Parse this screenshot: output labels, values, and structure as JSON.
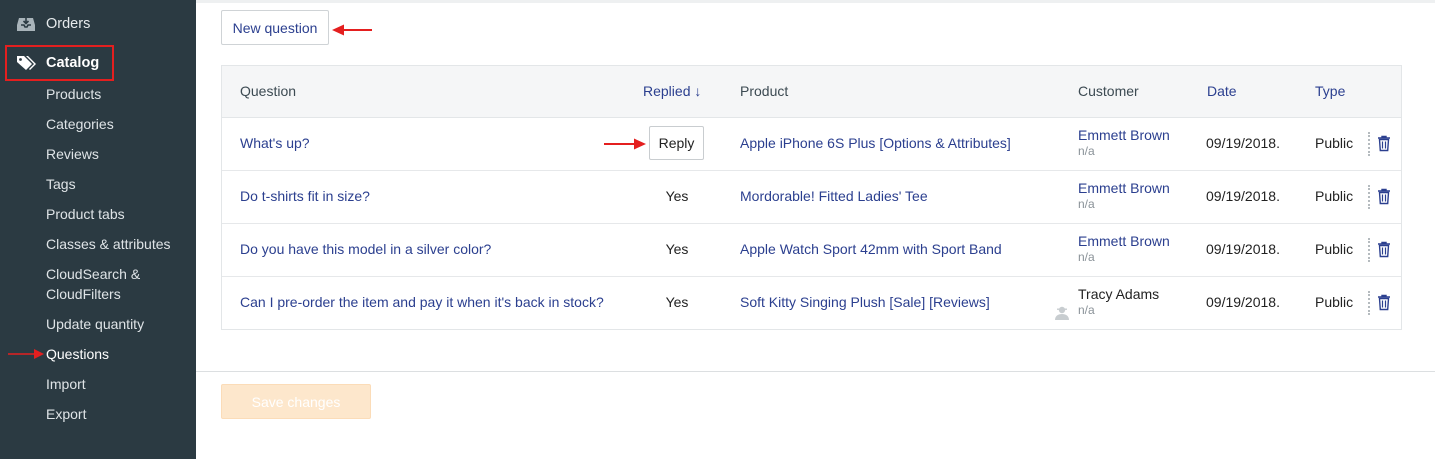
{
  "sidebar": {
    "orders_label": "Orders",
    "catalog_label": "Catalog",
    "items": [
      {
        "label": "Products"
      },
      {
        "label": "Categories"
      },
      {
        "label": "Reviews"
      },
      {
        "label": "Tags"
      },
      {
        "label": "Product tabs"
      },
      {
        "label": "Classes & attributes"
      },
      {
        "label": "CloudSearch &"
      },
      {
        "label": "CloudFilters"
      },
      {
        "label": "Update quantity"
      },
      {
        "label": "Questions"
      },
      {
        "label": "Import"
      },
      {
        "label": "Export"
      }
    ]
  },
  "toolbar": {
    "new_question_label": "New question"
  },
  "table": {
    "headers": {
      "question": "Question",
      "replied": "Replied ↓",
      "product": "Product",
      "customer": "Customer",
      "date": "Date",
      "type": "Type"
    },
    "rows": [
      {
        "question": "What's up?",
        "replied": "",
        "reply_button": "Reply",
        "product": "Apple iPhone 6S Plus [Options & Attributes]",
        "customer": "Emmett Brown",
        "customer_sub": "n/a",
        "date": "09/19/2018.",
        "type": "Public"
      },
      {
        "question": "Do t-shirts fit in size?",
        "replied": "Yes",
        "product": "Mordorable! Fitted Ladies' Tee",
        "customer": "Emmett Brown",
        "customer_sub": "n/a",
        "date": "09/19/2018.",
        "type": "Public"
      },
      {
        "question": "Do you have this model in a silver color?",
        "replied": "Yes",
        "product": "Apple Watch Sport 42mm with Sport Band",
        "customer": "Emmett Brown",
        "customer_sub": "n/a",
        "date": "09/19/2018.",
        "type": "Public"
      },
      {
        "question": "Can I pre-order the item and pay it when it's back in stock?",
        "replied": "Yes",
        "product": "Soft Kitty Singing Plush [Sale] [Reviews]",
        "customer": "Tracy Adams",
        "customer_sub": "n/a",
        "date": "09/19/2018.",
        "type": "Public"
      }
    ]
  },
  "footer": {
    "save_label": "Save changes"
  },
  "colors": {
    "sidebar_bg": "#2b3a42",
    "link": "#2b3f8f",
    "highlight": "#e41f1f",
    "save_bg": "#fde7cc"
  },
  "icons": [
    "inbox-icon",
    "tags-icon",
    "trash-icon",
    "user-ghost-icon",
    "annotation-arrow"
  ]
}
